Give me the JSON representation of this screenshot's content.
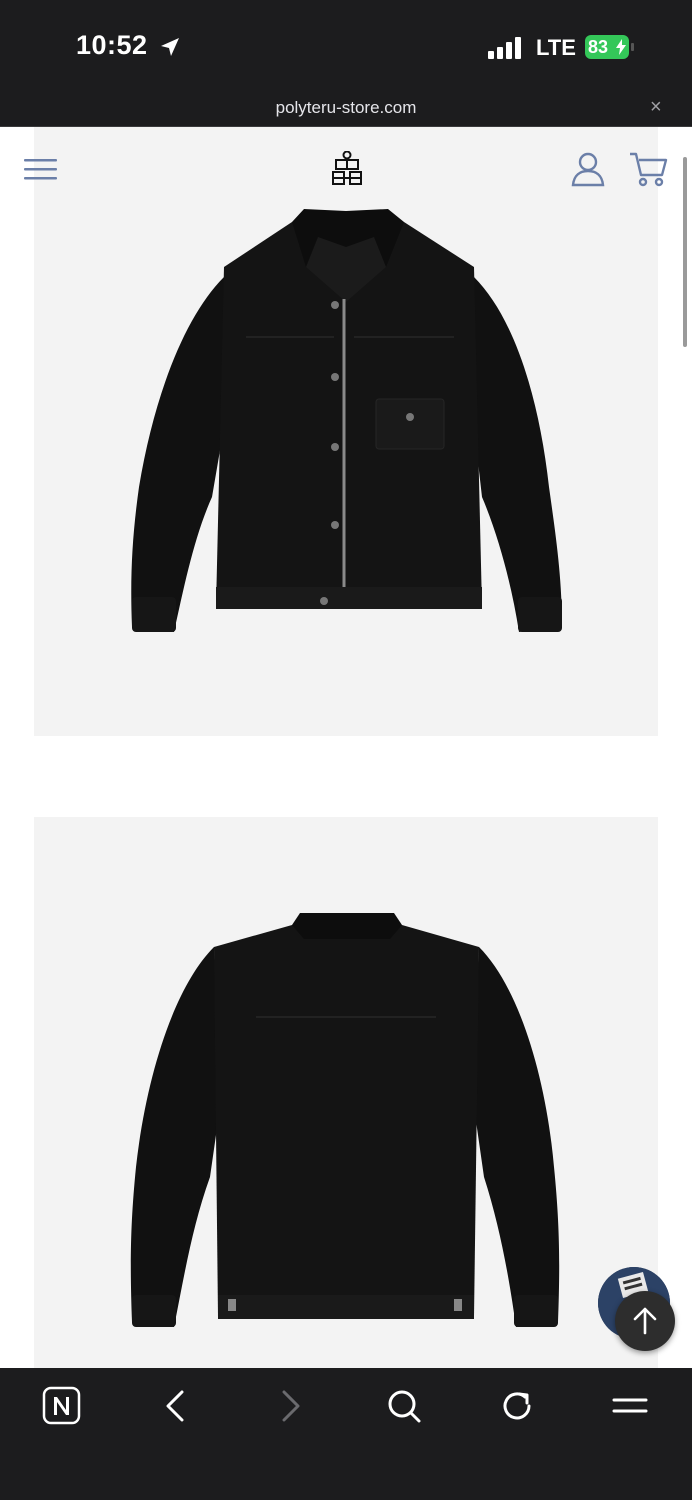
{
  "status_bar": {
    "time": "10:52",
    "network": "LTE",
    "battery": "83"
  },
  "browser": {
    "url": "polyteru-store.com",
    "close_symbol": "×"
  },
  "icons": {
    "location": "location-arrow-icon",
    "signal": "signal-bars-icon",
    "charging": "bolt-icon",
    "menu": "hamburger-menu-icon",
    "logo": "brand-logo",
    "account": "user-icon",
    "cart": "cart-icon",
    "scroll_top": "arrow-up-icon",
    "toolbar": [
      "naver-n-icon",
      "back-arrow-icon",
      "forward-arrow-icon",
      "search-icon",
      "reload-icon",
      "menu-lines-icon"
    ]
  },
  "colors": {
    "browser_chrome": "#1c1c1e",
    "battery": "#34c759",
    "header_icons": "#6b7fa8",
    "photo_bg": "#f3f3f3",
    "jacket": "#111111"
  }
}
